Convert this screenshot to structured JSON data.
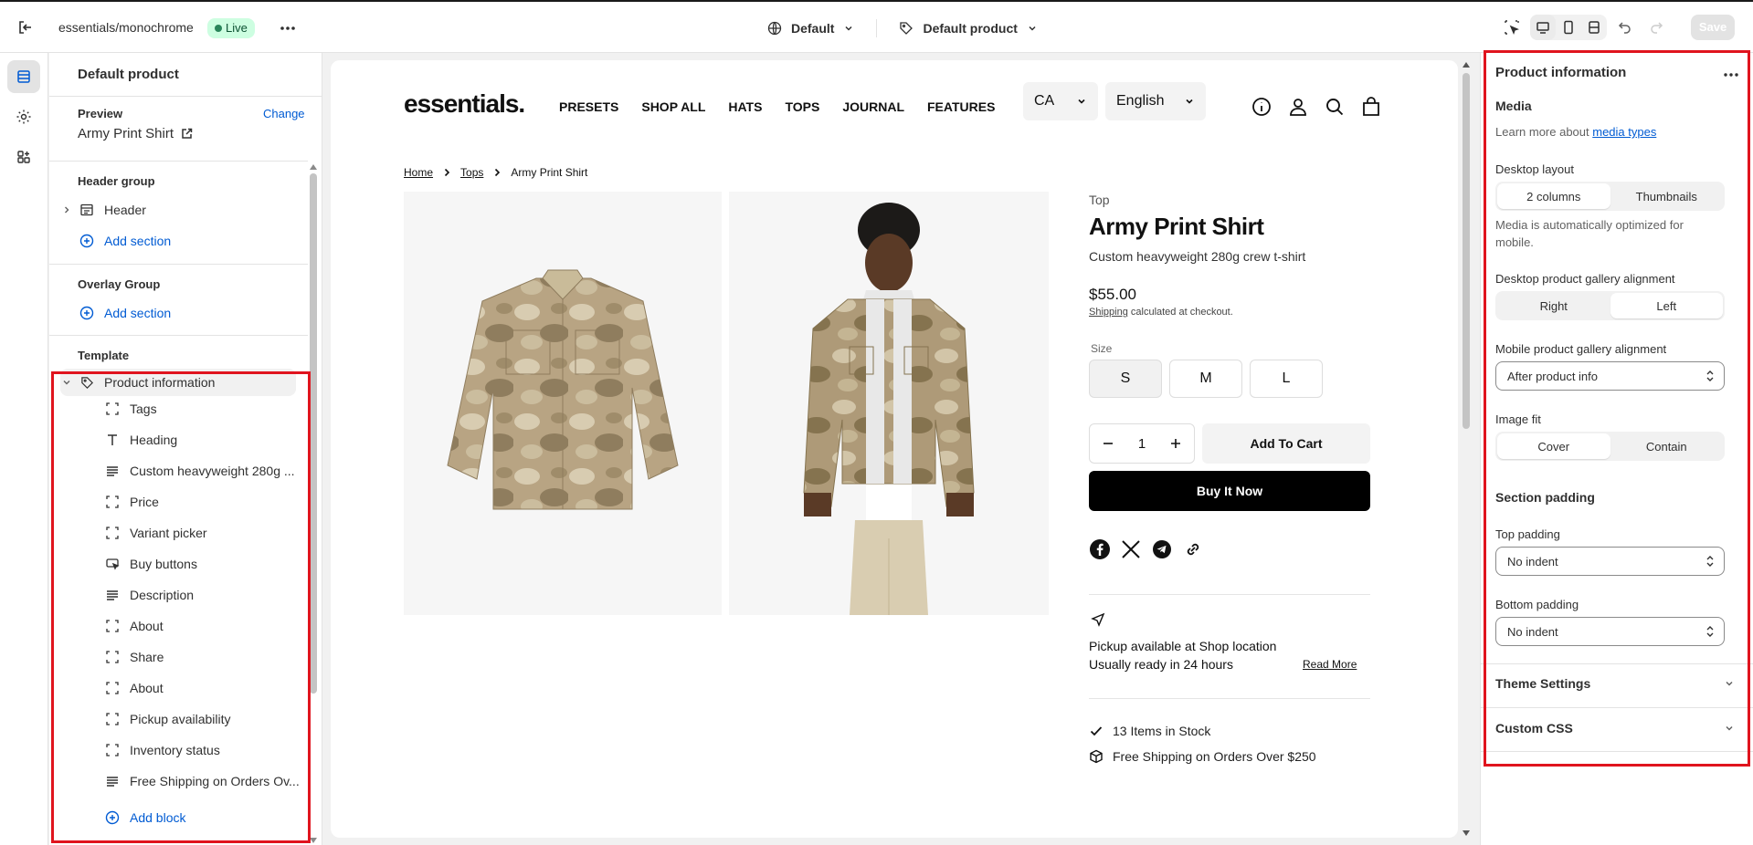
{
  "topbar": {
    "store_name": "essentials/monochrome",
    "live_badge": "Live",
    "theme_selector": "Default",
    "template_selector": "Default product",
    "save_label": "Save"
  },
  "sidebar": {
    "title": "Default product",
    "preview_label": "Preview",
    "change_label": "Change",
    "preview_value": "Army Print Shirt",
    "header_group": {
      "heading": "Header group",
      "items": [
        {
          "label": "Header"
        }
      ],
      "add_section": "Add section"
    },
    "overlay_group": {
      "heading": "Overlay Group",
      "add_section": "Add section"
    },
    "template": {
      "heading": "Template",
      "section_label": "Product information",
      "blocks": [
        {
          "label": "Tags",
          "icon": "block-icon"
        },
        {
          "label": "Heading",
          "icon": "text-icon"
        },
        {
          "label": "Custom heavyweight 280g ...",
          "icon": "paragraph-icon"
        },
        {
          "label": "Price",
          "icon": "block-icon"
        },
        {
          "label": "Variant picker",
          "icon": "block-icon"
        },
        {
          "label": "Buy buttons",
          "icon": "button-icon"
        },
        {
          "label": "Description",
          "icon": "paragraph-icon"
        },
        {
          "label": "About",
          "icon": "block-icon"
        },
        {
          "label": "Share",
          "icon": "block-icon"
        },
        {
          "label": "About",
          "icon": "block-icon"
        },
        {
          "label": "Pickup availability",
          "icon": "block-icon"
        },
        {
          "label": "Inventory status",
          "icon": "block-icon"
        },
        {
          "label": "Free Shipping on Orders Ov...",
          "icon": "paragraph-icon"
        }
      ],
      "add_block": "Add block"
    }
  },
  "store": {
    "logo": "essentials.",
    "nav": [
      "PRESETS",
      "SHOP ALL",
      "HATS",
      "TOPS",
      "JOURNAL",
      "FEATURES"
    ],
    "country": "CA",
    "language": "English",
    "breadcrumb": [
      "Home",
      "Tops",
      "Army Print Shirt"
    ],
    "product": {
      "type": "Top",
      "title": "Army Print Shirt",
      "subtitle": "Custom heavyweight 280g crew t-shirt",
      "price": "$55.00",
      "shipping_link": "Shipping",
      "shipping_text": " calculated at checkout.",
      "size_label": "Size",
      "sizes": [
        "S",
        "M",
        "L"
      ],
      "selected_size": "S",
      "quantity": "1",
      "add_to_cart": "Add To Cart",
      "buy_now": "Buy It Now",
      "pickup_line1": "Pickup available at Shop location",
      "pickup_line2": "Usually ready in 24 hours",
      "read_more": "Read More",
      "stock": "13 Items in Stock",
      "free_shipping": "Free Shipping on Orders Over $250"
    }
  },
  "settings": {
    "title": "Product information",
    "media_heading": "Media",
    "media_help_prefix": "Learn more about ",
    "media_help_link": "media types",
    "desktop_layout_label": "Desktop layout",
    "desktop_layout_options": [
      "2 columns",
      "Thumbnails"
    ],
    "desktop_layout_selected": "2 columns",
    "media_note": "Media is automatically optimized for mobile.",
    "gallery_alignment_label": "Desktop product gallery alignment",
    "gallery_alignment_options": [
      "Right",
      "Left"
    ],
    "gallery_alignment_selected": "Left",
    "mobile_alignment_label": "Mobile product gallery alignment",
    "mobile_alignment_value": "After product info",
    "image_fit_label": "Image fit",
    "image_fit_options": [
      "Cover",
      "Contain"
    ],
    "image_fit_selected": "Cover",
    "section_padding_heading": "Section padding",
    "top_padding_label": "Top padding",
    "top_padding_value": "No indent",
    "bottom_padding_label": "Bottom padding",
    "bottom_padding_value": "No indent",
    "theme_settings": "Theme Settings",
    "custom_css": "Custom CSS"
  },
  "colors": {
    "accent_link": "#005bd3",
    "live_bg": "#cdfee1",
    "highlight_box": "#e0141e",
    "buy_button": "#000000"
  }
}
